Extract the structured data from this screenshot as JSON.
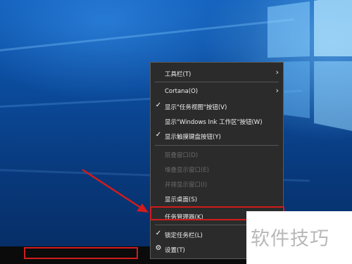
{
  "context_menu": {
    "items": [
      {
        "check": "",
        "label": "工具栏(T)",
        "chevron": "›",
        "enabled": true
      },
      {
        "check": "",
        "label": "Cortana(O)",
        "chevron": "›",
        "enabled": true
      },
      {
        "check": "✓",
        "label": "显示\"任务视图\"按钮(V)",
        "chevron": "",
        "enabled": true
      },
      {
        "check": "",
        "label": "显示\"Windows Ink 工作区\"按钮(W)",
        "chevron": "",
        "enabled": true
      },
      {
        "check": "✓",
        "label": "显示触摸键盘按钮(Y)",
        "chevron": "",
        "enabled": true
      },
      {
        "check": "",
        "label": "层叠窗口(D)",
        "chevron": "",
        "enabled": false
      },
      {
        "check": "",
        "label": "堆叠显示窗口(E)",
        "chevron": "",
        "enabled": false
      },
      {
        "check": "",
        "label": "并排显示窗口(I)",
        "chevron": "",
        "enabled": false
      },
      {
        "check": "",
        "label": "显示桌面(S)",
        "chevron": "",
        "enabled": true
      },
      {
        "check": "",
        "label": "任务管理器(K)",
        "chevron": "",
        "enabled": true
      },
      {
        "check": "✓",
        "label": "锁定任务栏(L)",
        "chevron": "",
        "enabled": true
      },
      {
        "check": "⚙",
        "label": "设置(T)",
        "chevron": "",
        "enabled": true
      }
    ]
  },
  "watermark": {
    "text": "软件技巧"
  },
  "colors": {
    "highlight": "#d11c1c",
    "menu_bg": "#2b2b2b",
    "taskbar": "#0b0b0b"
  },
  "icons": {
    "check": "check-icon",
    "gear": "gear-icon",
    "submenu": "chevron-right-icon"
  }
}
